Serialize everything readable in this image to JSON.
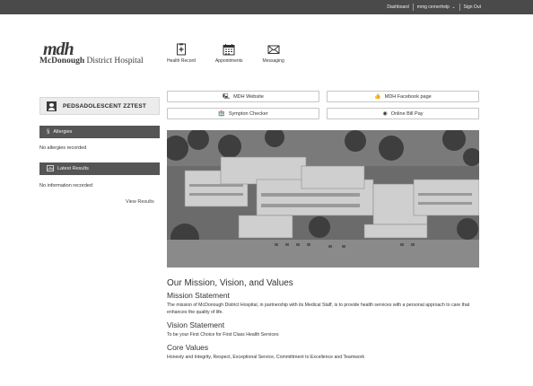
{
  "topbar": {
    "dashboard": "Dashboard",
    "user": "mmg cernerhelp",
    "chevron": "⌄",
    "sign_out": "Sign Out"
  },
  "logo": {
    "mark": "mdh",
    "name_bold": "McDonough",
    "name_rest": " District Hospital"
  },
  "nav": [
    {
      "label": "Health Record",
      "icon": "health-record-icon"
    },
    {
      "label": "Appointments",
      "icon": "calendar-icon"
    },
    {
      "label": "Messaging",
      "icon": "envelope-icon"
    }
  ],
  "sidebar": {
    "patient_name": "PEDSADOLESCENT ZZTEST",
    "allergies": {
      "title": "Allergies",
      "empty": "No allergies recorded"
    },
    "results": {
      "title": "Latest Results",
      "empty": "No information recorded",
      "link": "View Results"
    }
  },
  "links": {
    "website": "MDH Website",
    "facebook": "MDH Facebook page",
    "symptom": "Sympton Checker",
    "billpay": "Online Bill Pay"
  },
  "content": {
    "title": "Our Mission, Vision, and Values",
    "mission_heading": "Mission Statement",
    "mission_text": "The mission of McDonough District Hospital, in partnership with its Medical Staff, is to provide health services with a personal approach to care that enhances the quality of life.",
    "vision_heading": "Vision Statement",
    "vision_text": "To be your First Choice for First Class Health Services",
    "values_heading": "Core Values",
    "values_text": "Honesty and Integrity, Respect, Exceptional Service, Committment to Excellence and Teamwork"
  },
  "colors": {
    "topbar": "#4a4a4a",
    "side_header": "#555555",
    "patient_box": "#ececec"
  }
}
